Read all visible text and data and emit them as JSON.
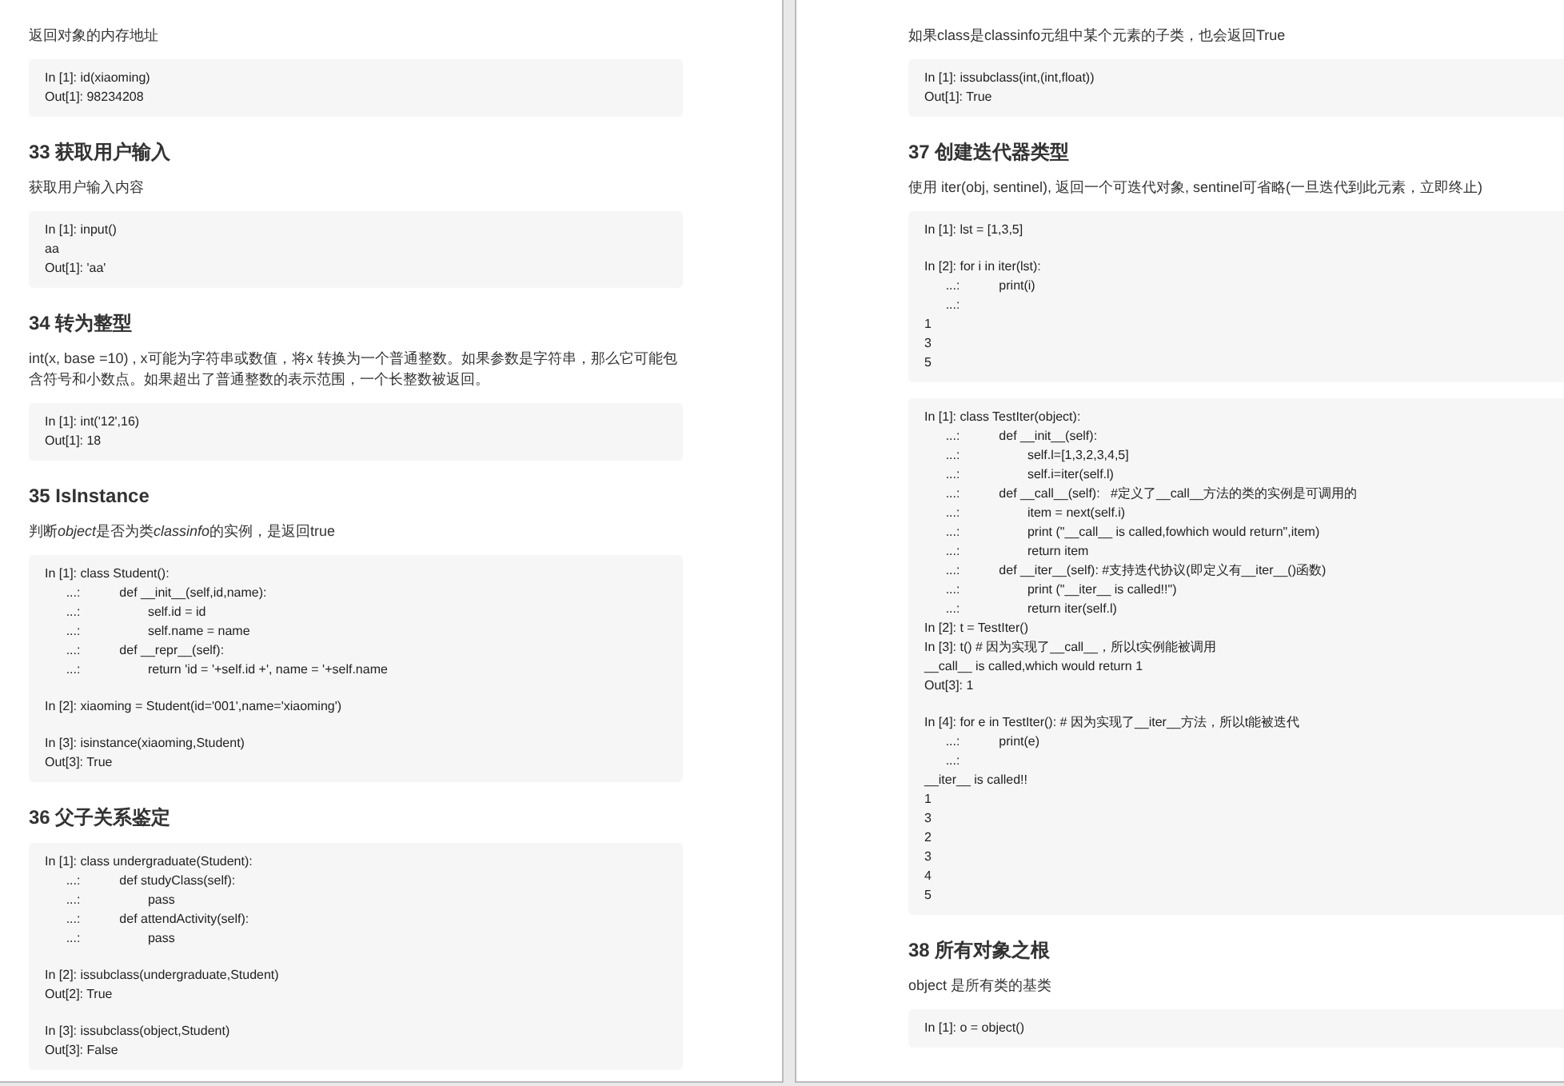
{
  "pages": [
    {
      "blocks": [
        {
          "kind": "para",
          "parts": [
            {
              "text": "返回对象的内存地址",
              "italic": false
            }
          ]
        },
        {
          "kind": "code",
          "cells": [
            [
              "In [1]: id(xiaoming)",
              "Out[1]: 98234208"
            ]
          ]
        },
        {
          "kind": "heading",
          "text": "33 获取用户输入"
        },
        {
          "kind": "para",
          "parts": [
            {
              "text": "获取用户输入内容",
              "italic": false
            }
          ]
        },
        {
          "kind": "code",
          "cells": [
            [
              "In [1]: input()",
              "aa",
              "Out[1]: 'aa'"
            ]
          ]
        },
        {
          "kind": "heading",
          "text": "34 转为整型"
        },
        {
          "kind": "para",
          "parts": [
            {
              "text": "int(x, base =10) , x可能为字符串或数值，将x 转换为一个普通整数。如果参数是字符串，那么它可能包含符号和小数点。如果超出了普通整数的表示范围，一个长整数被返回。",
              "italic": false
            }
          ]
        },
        {
          "kind": "code",
          "cells": [
            [
              "In [1]: int('12',16)",
              "Out[1]: 18"
            ]
          ]
        },
        {
          "kind": "heading",
          "text": "35 IsInstance"
        },
        {
          "kind": "para",
          "parts": [
            {
              "text": "判断",
              "italic": false
            },
            {
              "text": "object",
              "italic": true
            },
            {
              "text": "是否为类",
              "italic": false
            },
            {
              "text": "classinfo",
              "italic": true
            },
            {
              "text": "的实例，是返回true",
              "italic": false
            }
          ]
        },
        {
          "kind": "code",
          "cells": [
            [
              "In [1]: class Student():",
              "      ...:           def __init__(self,id,name):",
              "      ...:                   self.id = id",
              "      ...:                   self.name = name",
              "      ...:           def __repr__(self):",
              "      ...:                   return 'id = '+self.id +', name = '+self.name"
            ],
            [
              "In [2]: xiaoming = Student(id='001',name='xiaoming')"
            ],
            [
              "In [3]: isinstance(xiaoming,Student)",
              "Out[3]: True"
            ]
          ]
        },
        {
          "kind": "heading",
          "text": "36 父子关系鉴定"
        },
        {
          "kind": "code",
          "cells": [
            [
              "In [1]: class undergraduate(Student):",
              "      ...:           def studyClass(self):",
              "      ...:                   pass",
              "      ...:           def attendActivity(self):",
              "      ...:                   pass"
            ],
            [
              "In [2]: issubclass(undergraduate,Student)",
              "Out[2]: True"
            ],
            [
              "In [3]: issubclass(object,Student)",
              "Out[3]: False"
            ]
          ]
        }
      ]
    },
    {
      "blocks": [
        {
          "kind": "para",
          "parts": [
            {
              "text": "如果class是classinfo元组中某个元素的子类，也会返回True",
              "italic": false
            }
          ]
        },
        {
          "kind": "code",
          "cells": [
            [
              "In [1]: issubclass(int,(int,float))",
              "Out[1]: True"
            ]
          ]
        },
        {
          "kind": "heading",
          "text": "37 创建迭代器类型"
        },
        {
          "kind": "para",
          "parts": [
            {
              "text": "使用 iter(obj, sentinel), 返回一个可迭代对象, sentinel可省略(一旦迭代到此元素，立即终止)",
              "italic": false
            }
          ]
        },
        {
          "kind": "code",
          "cells": [
            [
              "In [1]: lst = [1,3,5]"
            ],
            [
              "In [2]: for i in iter(lst):",
              "      ...:           print(i)",
              "      ...:",
              "1",
              "3",
              "5"
            ]
          ]
        },
        {
          "kind": "code",
          "cells": [
            [
              "In [1]: class TestIter(object):",
              "      ...:           def __init__(self):",
              "      ...:                   self.l=[1,3,2,3,4,5]",
              "      ...:                   self.i=iter(self.l)",
              "      ...:           def __call__(self):   #定义了__call__方法的类的实例是可调用的",
              "      ...:                   item = next(self.i)",
              "      ...:                   print (\"__call__ is called,fowhich would return\",item)",
              "      ...:                   return item",
              "      ...:           def __iter__(self): #支持迭代协议(即定义有__iter__()函数)",
              "      ...:                   print (\"__iter__ is called!!\")",
              "      ...:                   return iter(self.l)",
              "In [2]: t = TestIter()",
              "In [3]: t() # 因为实现了__call__，所以t实例能被调用",
              "__call__ is called,which would return 1",
              "Out[3]: 1"
            ],
            [
              "In [4]: for e in TestIter(): # 因为实现了__iter__方法，所以t能被迭代",
              "      ...:           print(e)",
              "      ...:",
              "__iter__ is called!!",
              "1",
              "3",
              "2",
              "3",
              "4",
              "5"
            ]
          ]
        },
        {
          "kind": "heading",
          "text": "38 所有对象之根"
        },
        {
          "kind": "para",
          "parts": [
            {
              "text": "object 是所有类的基类",
              "italic": false
            }
          ]
        },
        {
          "kind": "code",
          "cells": [
            [
              "In [1]: o = object()"
            ]
          ]
        }
      ]
    }
  ]
}
